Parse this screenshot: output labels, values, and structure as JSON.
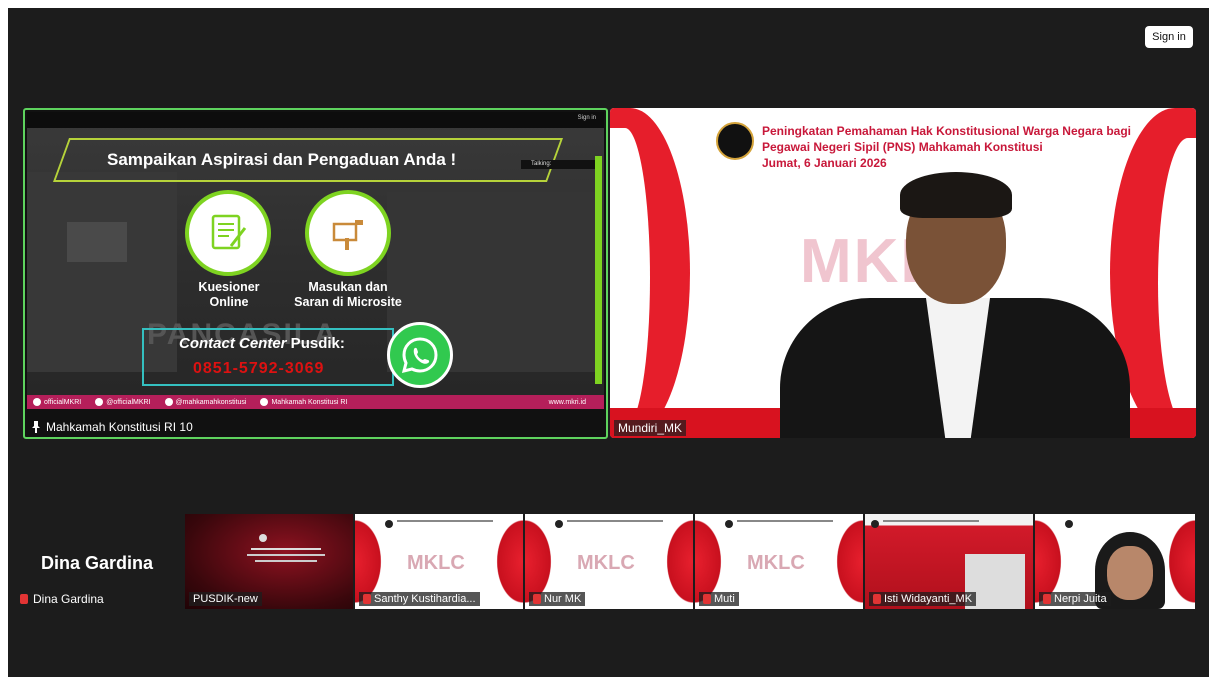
{
  "header": {
    "sign_in_label": "Sign in"
  },
  "main_tile": {
    "top_mini_label": "Sign in",
    "banner": "Sampaikan Aspirasi dan Pengaduan Anda !",
    "talking_label": "Talking:",
    "option1_line1": "Kuesioner",
    "option1_line2": "Online",
    "option2_line1": "Masukan dan",
    "option2_line2": "Saran di Microsite",
    "contact_title_italic": "Contact Center",
    "contact_title_rest": " Pusdik:",
    "contact_phone": "0851-5792-3069",
    "watermark_text": "PANCASILA",
    "social": [
      "officialMKRI",
      "@officialMKRI",
      "@mahkamahkonstitusi",
      "Mahkamah Konstitusi RI"
    ],
    "website": "www.mkri.id",
    "participant_name": "Mahkamah Konstitusi RI 10"
  },
  "speaker_tile": {
    "heading_line1": "Peningkatan Pemahaman Hak Konstitusional Warga Negara bagi",
    "heading_line2": "Pegawai Negeri Sipil (PNS) Mahkamah Konstitusi",
    "heading_line3": "Jumat, 6 Januari 2026",
    "watermark": "MKLC",
    "participant_name": "Mundiri_MK"
  },
  "bottom_strip": {
    "self_big_name": "Dina Gardina",
    "self_label": "Dina Gardina",
    "thumbs": [
      {
        "label": "PUSDIK-new",
        "muted": false
      },
      {
        "label": "Santhy Kustihardia...",
        "muted": true
      },
      {
        "label": "Nur MK",
        "muted": true
      },
      {
        "label": "Muti",
        "muted": true
      },
      {
        "label": "Isti Widayanti_MK",
        "muted": true
      },
      {
        "label": "Nerpi Juita",
        "muted": true
      }
    ],
    "thumb_watermark": "MKLC"
  },
  "colors": {
    "active_speaker_border": "#5ed35e",
    "accent_red": "#c8183a",
    "muted_icon": "#e23434"
  }
}
